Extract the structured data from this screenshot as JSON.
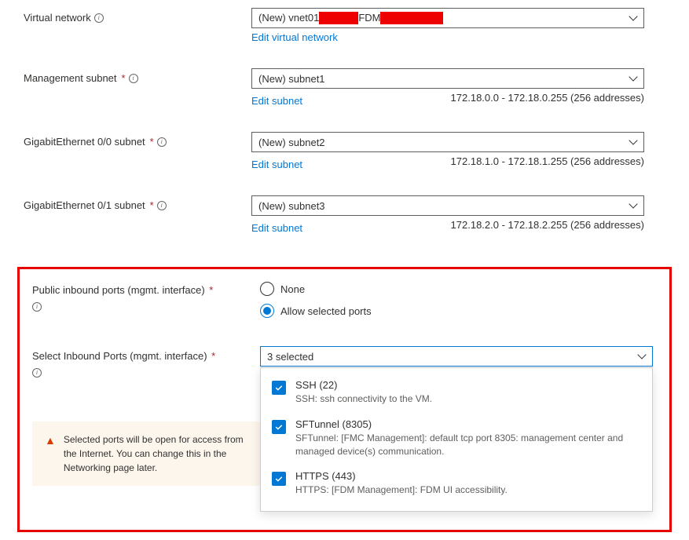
{
  "fields": {
    "vnet": {
      "label": "Virtual network",
      "value_prefix": "(New) vnet01",
      "value_mid": "FDM",
      "edit_link": "Edit virtual network"
    },
    "mgmt_subnet": {
      "label": "Management subnet",
      "value": "(New) subnet1",
      "edit_link": "Edit subnet",
      "range": "172.18.0.0 - 172.18.0.255 (256 addresses)"
    },
    "ge00_subnet": {
      "label": "GigabitEthernet 0/0 subnet",
      "value": "(New) subnet2",
      "edit_link": "Edit subnet",
      "range": "172.18.1.0 - 172.18.1.255 (256 addresses)"
    },
    "ge01_subnet": {
      "label": "GigabitEthernet 0/1 subnet",
      "value": "(New) subnet3",
      "edit_link": "Edit subnet",
      "range": "172.18.2.0 - 172.18.2.255 (256 addresses)"
    },
    "public_ports": {
      "label": "Public inbound ports (mgmt. interface)",
      "options": {
        "none": "None",
        "allow": "Allow selected ports"
      }
    },
    "select_ports": {
      "label": "Select Inbound Ports (mgmt. interface)",
      "selected_summary": "3 selected",
      "options": [
        {
          "title": "SSH (22)",
          "desc": "SSH: ssh connectivity to the VM."
        },
        {
          "title": "SFTunnel (8305)",
          "desc": "SFTunnel: [FMC Management]: default tcp port 8305: management center and managed device(s) communication."
        },
        {
          "title": "HTTPS (443)",
          "desc": "HTTPS: [FDM Management]: FDM UI accessibility."
        }
      ]
    }
  },
  "warning": "Selected ports will be open for access from the Internet. You can change this in the Networking page later."
}
